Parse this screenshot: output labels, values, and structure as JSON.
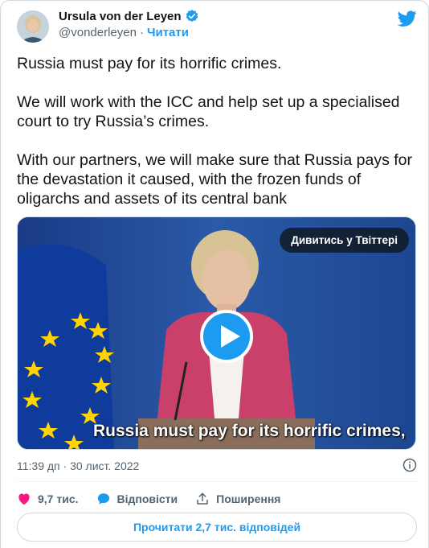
{
  "author": {
    "name": "Ursula von der Leyen",
    "handle": "@vonderleyen",
    "separator": "·",
    "follow_label": "Читати"
  },
  "tweet": {
    "paragraphs": [
      "Russia must pay for its horrific crimes.",
      "We will work with the ICC and help set up a specialised court to try Russia’s crimes.",
      "With our partners, we will make sure that Russia pays for the devastation it caused, with the frozen funds of oligarchs and assets of its central bank"
    ]
  },
  "media": {
    "watch_label": "Дивитись у Твіттері",
    "caption": "Russia must pay for its horrific crimes,"
  },
  "meta": {
    "time": "11:39 дп",
    "separator": "·",
    "date": "30 лист. 2022"
  },
  "actions": {
    "likes": "9,7 тис.",
    "reply_label": "Відповісти",
    "share_label": "Поширення"
  },
  "read_replies_label": "Прочитати 2,7 тис. відповідей",
  "colors": {
    "accent": "#1d9bf0",
    "like": "#f91880",
    "text": "#0f1419",
    "muted": "#536471"
  }
}
